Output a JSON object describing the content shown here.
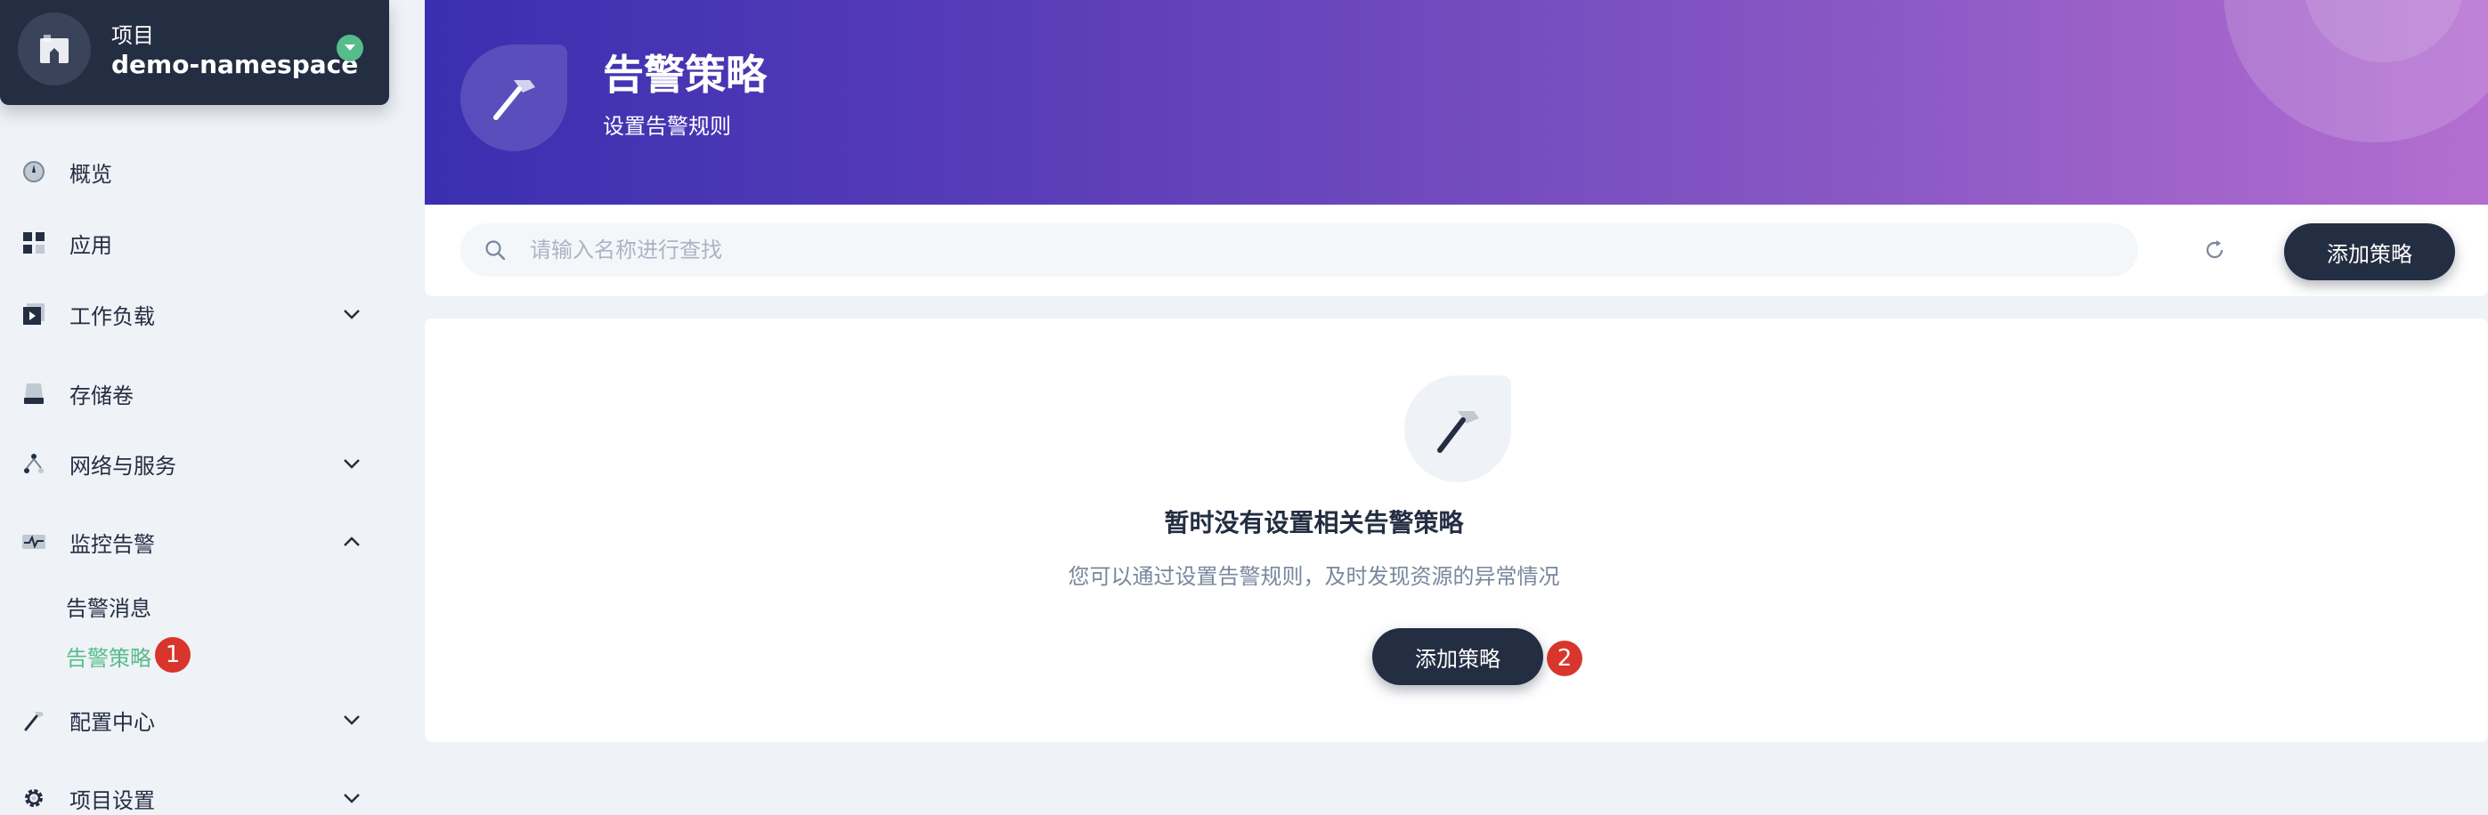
{
  "project": {
    "label": "项目",
    "name": "demo-namespace"
  },
  "nav": {
    "overview": "概览",
    "apps": "应用",
    "workloads": "工作负载",
    "volumes": "存储卷",
    "network": "网络与服务",
    "monitoring": "监控告警",
    "monitoring_children": {
      "alert_messages": "告警消息",
      "alert_policies": "告警策略"
    },
    "config_center": "配置中心",
    "project_settings": "项目设置"
  },
  "markers": {
    "first": "1",
    "second": "2"
  },
  "banner": {
    "title": "告警策略",
    "description": "设置告警规则"
  },
  "toolbar": {
    "search_placeholder": "请输入名称进行查找",
    "add_label": "添加策略"
  },
  "empty": {
    "title": "暂时没有设置相关告警策略",
    "description": "您可以通过设置告警规则，及时发现资源的异常情况",
    "button_label": "添加策略"
  },
  "colors": {
    "accent_green": "#55bc8a",
    "dark": "#242e42",
    "marker_red": "#d8352c"
  },
  "icons": {
    "project": "project-icon",
    "overview": "dashboard-icon",
    "apps": "appcenter-icon",
    "workloads": "workload-icon",
    "volumes": "storage-icon",
    "network": "network-router-icon",
    "monitoring": "monitor-icon",
    "config": "hammer-icon",
    "settings": "gear-icon",
    "search": "search-icon",
    "refresh": "refresh-icon"
  }
}
